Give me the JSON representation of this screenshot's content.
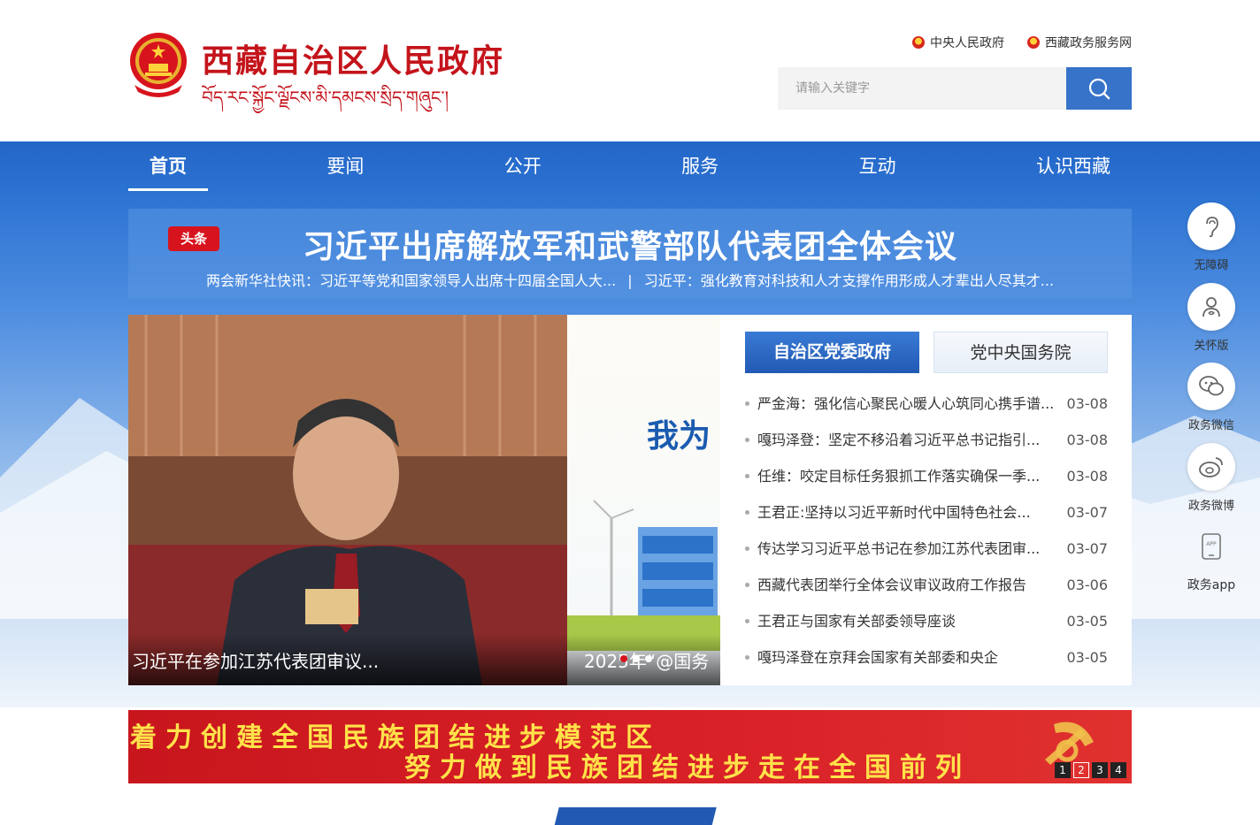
{
  "header": {
    "site_title": "西藏自治区人民政府",
    "site_subtitle": "བོད་རང་སྐྱོང་ལྗོངས་མི་དམངས་སྲིད་གཞུང་།",
    "top_links": [
      "中央人民政府",
      "西藏政务服务网"
    ],
    "search_placeholder": "请输入关键字"
  },
  "nav": {
    "items": [
      "首页",
      "要闻",
      "公开",
      "服务",
      "互动",
      "认识西藏"
    ]
  },
  "headline": {
    "badge": "头条",
    "title": "习近平出席解放军和武警部队代表团全体会议",
    "sub1": "两会新华社快讯：习近平等党和国家领导人出席十四届全国人大...",
    "separator": "|",
    "sub2": "习近平：强化教育对科技和人才支撑作用形成人才辈出人尽其才..."
  },
  "slides": {
    "caption1": "习近平在参加江苏代表团审议...",
    "caption2": "2025年“@国务",
    "slide2_text": "我为"
  },
  "news": {
    "tabs": [
      "自治区党委政府",
      "党中央国务院"
    ],
    "items": [
      {
        "title": "严金海：强化信心聚民心暖人心筑同心携手谱...",
        "date": "03-08"
      },
      {
        "title": "嘎玛泽登：坚定不移沿着习近平总书记指引...",
        "date": "03-08"
      },
      {
        "title": "任维：咬定目标任务狠抓工作落实确保一季...",
        "date": "03-08"
      },
      {
        "title": "王君正:坚持以习近平新时代中国特色社会...",
        "date": "03-07"
      },
      {
        "title": "传达学习习近平总书记在参加江苏代表团审...",
        "date": "03-07"
      },
      {
        "title": "西藏代表团举行全体会议审议政府工作报告",
        "date": "03-06"
      },
      {
        "title": "王君正与国家有关部委领导座谈",
        "date": "03-05"
      },
      {
        "title": "嘎玛泽登在京拜会国家有关部委和央企",
        "date": "03-05"
      }
    ]
  },
  "side_tools": [
    "无障碍",
    "关怀版",
    "政务微信",
    "政务微博",
    "政务app"
  ],
  "banner": {
    "line1": "着力创建全国民族团结进步模范区",
    "line2": "努力做到民族团结进步走在全国前列",
    "pages": [
      "1",
      "2",
      "3",
      "4"
    ]
  },
  "colors": {
    "brand_red": "#c4141b",
    "nav_blue": "#2366c8",
    "search_blue": "#3673c9",
    "banner_yellow": "#ffe24a"
  }
}
